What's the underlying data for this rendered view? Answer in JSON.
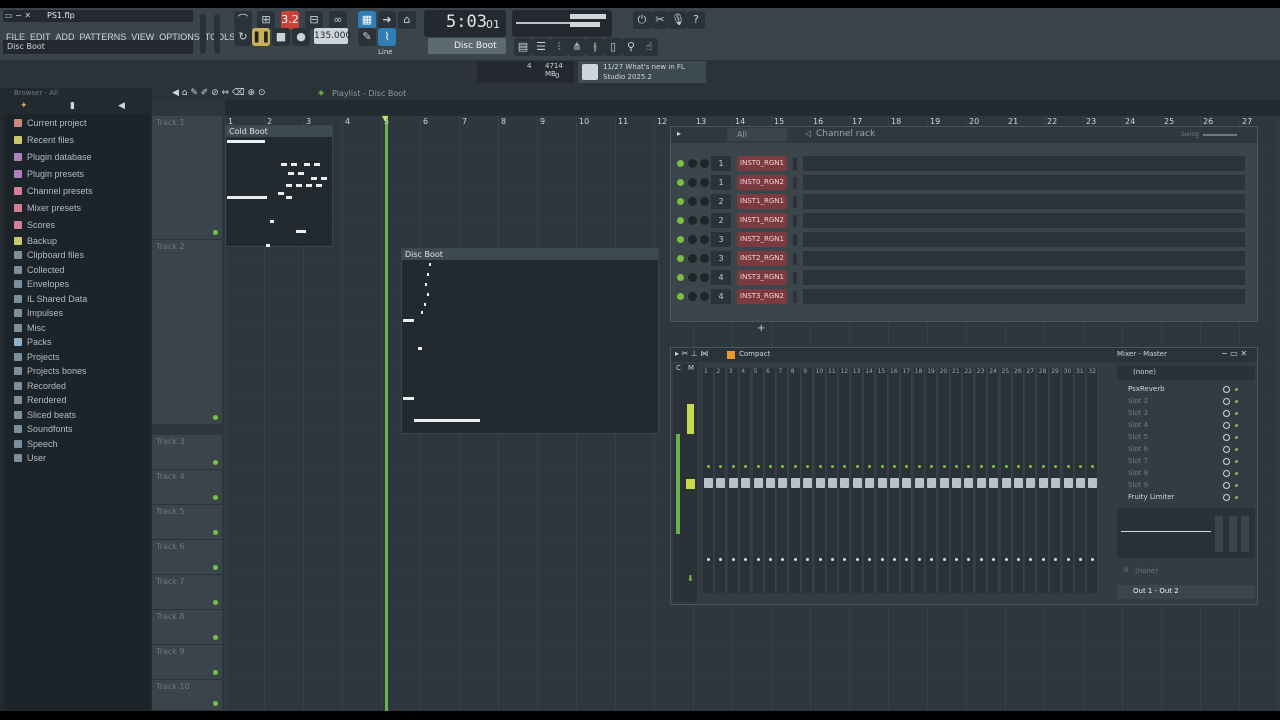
{
  "app": {
    "file_name": "PS1.flp",
    "hint": "Disc Boot"
  },
  "menu": [
    "FILE",
    "EDIT",
    "ADD",
    "PATTERNS",
    "VIEW",
    "OPTIONS",
    "TOOLS",
    "?"
  ],
  "transport": {
    "time": "5:03",
    "time_sub": "01",
    "tempo": "135.000",
    "pattern_name": "Disc Boot",
    "snap": "Line"
  },
  "cpu": {
    "mem": "4714 MB",
    "val1": "4",
    "val2": "0"
  },
  "news": {
    "line1": "11/27  What's new in FL",
    "line2": "Studio 2025.2"
  },
  "browser": {
    "header": "Browser - All",
    "items": [
      "Current project",
      "Recent files",
      "Plugin database",
      "Plugin presets",
      "Channel presets",
      "Mixer presets",
      "Scores",
      "Backup",
      "Clipboard files",
      "Collected",
      "Envelopes",
      "IL Shared Data",
      "Impulses",
      "Misc",
      "Packs",
      "Projects",
      "Projects bones",
      "Recorded",
      "Rendered",
      "Sliced beats",
      "Soundfonts",
      "Speech",
      "User"
    ]
  },
  "playlist": {
    "title": "Playlist - Disc Boot",
    "ruler": [
      "1",
      "2",
      "3",
      "4",
      "5",
      "6",
      "7",
      "8",
      "9",
      "10",
      "11",
      "12",
      "13",
      "14",
      "15",
      "16",
      "17",
      "18",
      "19",
      "20",
      "21",
      "22",
      "23",
      "24",
      "25",
      "26",
      "27"
    ],
    "tracks": [
      "Track 1",
      "Track 2",
      "Track 3",
      "Track 4",
      "Track 5",
      "Track 6",
      "Track 7",
      "Track 8",
      "Track 9",
      "Track 10"
    ],
    "patterns": [
      "Cold Boot",
      "Disc Boot"
    ]
  },
  "channel_rack": {
    "title": "Channel rack",
    "filter": "All",
    "swing": "Swing",
    "channels": [
      {
        "num": "1",
        "name": "INST0_RGN1"
      },
      {
        "num": "1",
        "name": "INST0_RGN2"
      },
      {
        "num": "2",
        "name": "INST1_RGN1"
      },
      {
        "num": "2",
        "name": "INST1_RGN2"
      },
      {
        "num": "3",
        "name": "INST2_RGN1"
      },
      {
        "num": "3",
        "name": "INST2_RGN2"
      },
      {
        "num": "4",
        "name": "INST3_RGN1"
      },
      {
        "num": "4",
        "name": "INST3_RGN2"
      }
    ],
    "add": "+"
  },
  "mixer": {
    "view": "Compact",
    "title": "Mixer - Master",
    "header_labels": [
      "C",
      "M"
    ],
    "channel_numbers": [
      "1",
      "2",
      "3",
      "4",
      "5",
      "6",
      "7",
      "8",
      "9",
      "10",
      "11",
      "12",
      "13",
      "14",
      "15",
      "16",
      "17",
      "18",
      "19",
      "20",
      "21",
      "22",
      "23",
      "24",
      "25",
      "26",
      "27",
      "28",
      "29",
      "30",
      "31",
      "32"
    ],
    "preset": "(none)",
    "slots": [
      "PsxReverb",
      "Slot 2",
      "Slot 3",
      "Slot 4",
      "Slot 5",
      "Slot 6",
      "Slot 7",
      "Slot 8",
      "Slot 9",
      "Fruity Limiter"
    ],
    "eq_preset": "(none)",
    "output": "Out 1 - Out 2"
  }
}
